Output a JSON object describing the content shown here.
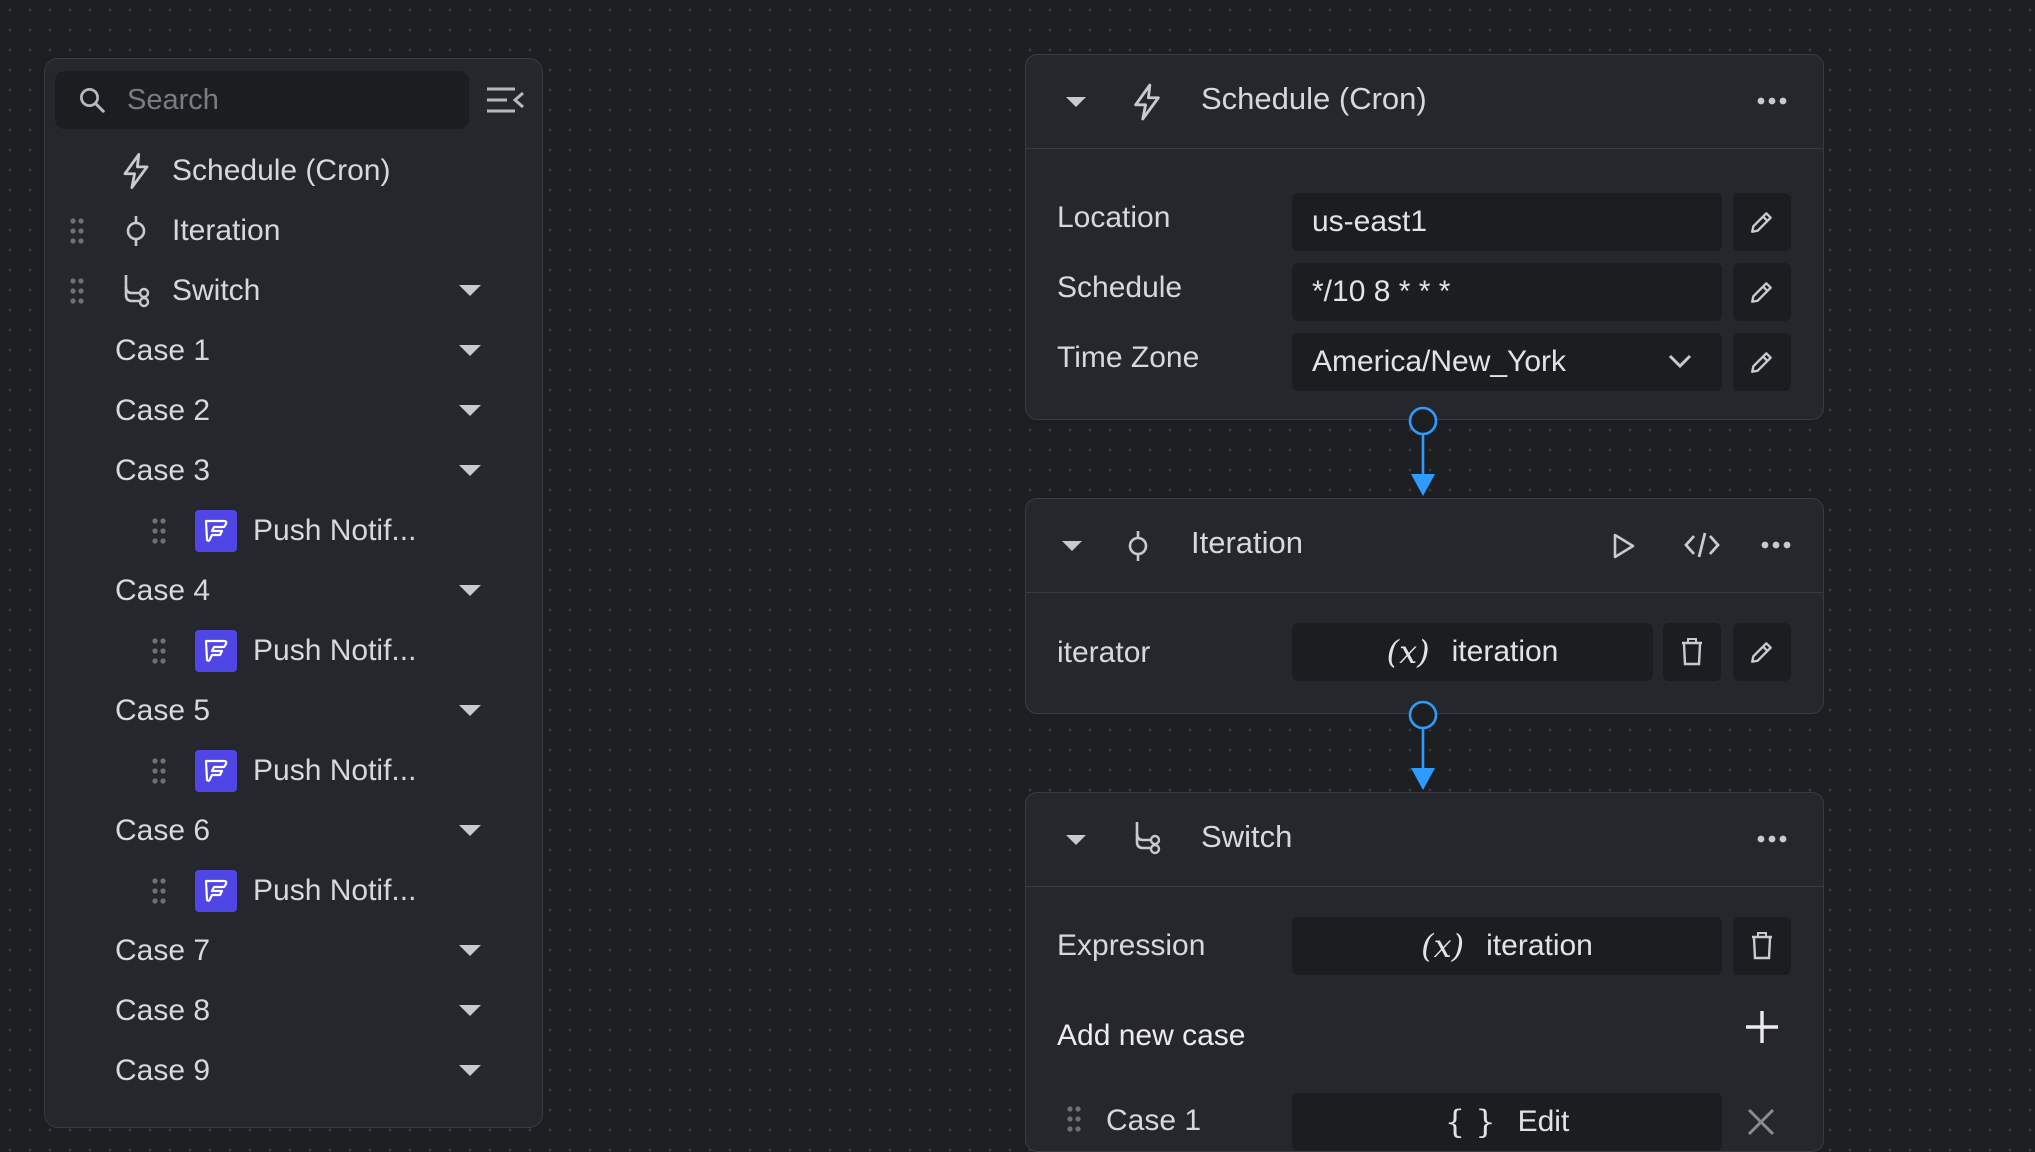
{
  "sidebar": {
    "search_placeholder": "Search",
    "items": [
      {
        "label": "Schedule (Cron)",
        "icon": "bolt-icon"
      },
      {
        "label": "Iteration",
        "icon": "iteration-icon"
      },
      {
        "label": "Switch",
        "icon": "switch-branch-icon"
      },
      {
        "label": "Case 1"
      },
      {
        "label": "Case 2"
      },
      {
        "label": "Case 3"
      },
      {
        "label": "Push Notif...",
        "icon": "flutterflow-icon"
      },
      {
        "label": "Case 4"
      },
      {
        "label": "Push Notif...",
        "icon": "flutterflow-icon"
      },
      {
        "label": "Case 5"
      },
      {
        "label": "Push Notif...",
        "icon": "flutterflow-icon"
      },
      {
        "label": "Case 6"
      },
      {
        "label": "Push Notif...",
        "icon": "flutterflow-icon"
      },
      {
        "label": "Case 7"
      },
      {
        "label": "Case 8"
      },
      {
        "label": "Case 9"
      }
    ]
  },
  "schedule_node": {
    "title": "Schedule (Cron)",
    "fields": [
      {
        "label": "Location",
        "value": "us-east1"
      },
      {
        "label": "Schedule",
        "value": "*/10 8 * * *"
      },
      {
        "label": "Time Zone",
        "value": "America/New_York"
      }
    ]
  },
  "iteration_node": {
    "title": "Iteration",
    "iterator_label": "iterator",
    "iterator_var_symbol": "(x)",
    "iterator_value": "iteration"
  },
  "switch_node": {
    "title": "Switch",
    "expression_label": "Expression",
    "expression_var_symbol": "(x)",
    "expression_value": "iteration",
    "add_case_label": "Add new case",
    "first_case_label": "Case 1",
    "first_case_value": "Edit"
  },
  "colors": {
    "background": "#1d1e22",
    "panel": "#26272c",
    "input": "#1c1d21",
    "connector": "#2f9bff",
    "flutterflow_badge": "#4f46e5"
  }
}
